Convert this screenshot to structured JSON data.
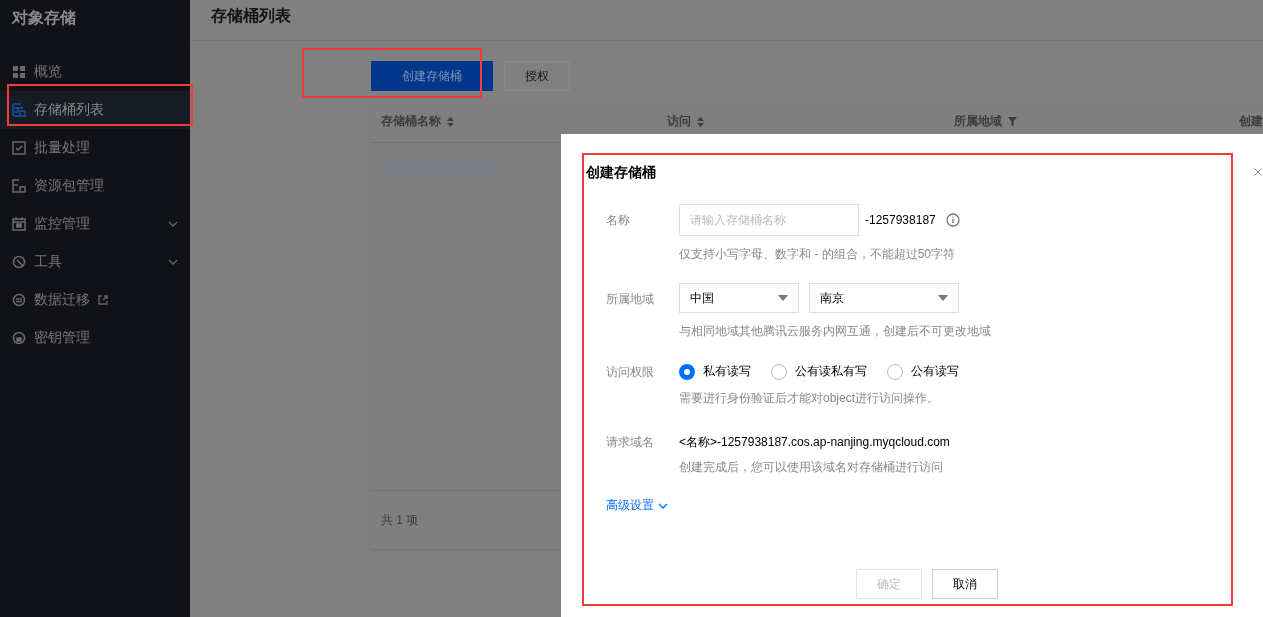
{
  "sidebar": {
    "title": "对象存储",
    "items": [
      {
        "label": "概览",
        "selected": false,
        "expandable": false,
        "external": false
      },
      {
        "label": "存储桶列表",
        "selected": true,
        "expandable": false,
        "external": false
      },
      {
        "label": "批量处理",
        "selected": false,
        "expandable": false,
        "external": false
      },
      {
        "label": "资源包管理",
        "selected": false,
        "expandable": false,
        "external": false
      },
      {
        "label": "监控管理",
        "selected": false,
        "expandable": true,
        "external": false
      },
      {
        "label": "工具",
        "selected": false,
        "expandable": true,
        "external": false
      },
      {
        "label": "数据迁移",
        "selected": false,
        "expandable": false,
        "external": true
      },
      {
        "label": "密钥管理",
        "selected": false,
        "expandable": false,
        "external": false
      }
    ]
  },
  "page_title": "存储桶列表",
  "toolbar": [
    {
      "label": "创建存储桶",
      "kind": "primary"
    },
    {
      "label": "授权",
      "kind": "default"
    }
  ],
  "table": {
    "columns": [
      {
        "label": "存储桶名称",
        "sortable": true,
        "filterable": false
      },
      {
        "label": "访问",
        "sortable": true,
        "filterable": false
      },
      {
        "label": "所属地域",
        "sortable": false,
        "filterable": true
      },
      {
        "label": "创建"
      }
    ],
    "footer": "共 1 项"
  },
  "dialog": {
    "title": "创建存储桶",
    "name": {
      "label": "名称",
      "placeholder": "请输入存储桶名称",
      "suffix": "-1257938187",
      "hint": "仅支持小写字母、数字和 - 的组合，不能超过50字符"
    },
    "region": {
      "label": "所属地域",
      "selects": [
        "中国",
        "南京"
      ],
      "hint": "与相同地域其他腾讯云服务内网互通，创建后不可更改地域"
    },
    "access": {
      "label": "访问权限",
      "options": [
        {
          "label": "私有读写",
          "selected": true
        },
        {
          "label": "公有读私有写",
          "selected": false
        },
        {
          "label": "公有读写",
          "selected": false
        }
      ],
      "hint": "需要进行身份验证后才能对object进行访问操作。"
    },
    "domain": {
      "label": "请求域名",
      "value": "<名称>-1257938187.cos.ap-nanjing.myqcloud.com",
      "hint": "创建完成后，您可以使用该域名对存储桶进行访问"
    },
    "advanced": "高级设置",
    "buttons": [
      {
        "label": "确定",
        "disabled": true
      },
      {
        "label": "取消",
        "disabled": false
      }
    ]
  }
}
